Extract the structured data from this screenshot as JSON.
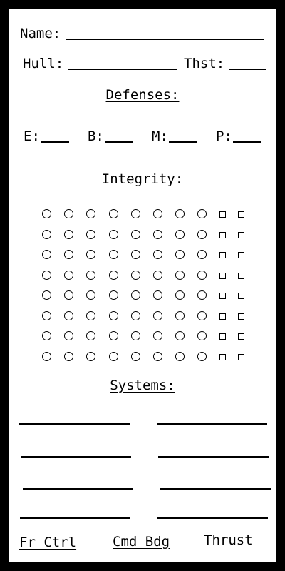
{
  "sheet": {
    "name_label": "Name:",
    "hull_label": "Hull:",
    "thrust_label": "Thst:",
    "defenses_heading": "Defenses:",
    "defenses": [
      {
        "label": "E:"
      },
      {
        "label": "B:"
      },
      {
        "label": "M:"
      },
      {
        "label": "P:"
      }
    ],
    "integrity_heading": "Integrity:",
    "integrity_grid": {
      "rows": 8,
      "circles_per_row": 8,
      "squares_per_row": 2
    },
    "systems_heading": "Systems:",
    "systems_slots": 8,
    "footer": {
      "fire_control": "Fr Ctrl",
      "command_badge": "Cmd Bdg",
      "thrust": "Thrust"
    }
  }
}
